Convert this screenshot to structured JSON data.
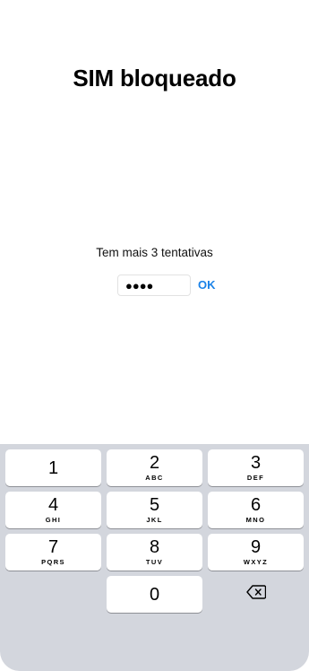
{
  "screen": {
    "title": "SIM bloqueado",
    "attempts_text": "Tem mais 3 tentativas",
    "pin_value": "●●●●",
    "ok_label": "OK"
  },
  "keypad": {
    "keys": [
      {
        "digit": "1",
        "letters": ""
      },
      {
        "digit": "2",
        "letters": "ABC"
      },
      {
        "digit": "3",
        "letters": "DEF"
      },
      {
        "digit": "4",
        "letters": "GHI"
      },
      {
        "digit": "5",
        "letters": "JKL"
      },
      {
        "digit": "6",
        "letters": "MNO"
      },
      {
        "digit": "7",
        "letters": "PQRS"
      },
      {
        "digit": "8",
        "letters": "TUV"
      },
      {
        "digit": "9",
        "letters": "WXYZ"
      },
      {
        "digit": "0",
        "letters": ""
      }
    ],
    "backspace_icon": "backspace-icon"
  },
  "colors": {
    "accent": "#1a82e8",
    "keypad_bg": "#d3d6dd",
    "key_bg": "#ffffff"
  }
}
